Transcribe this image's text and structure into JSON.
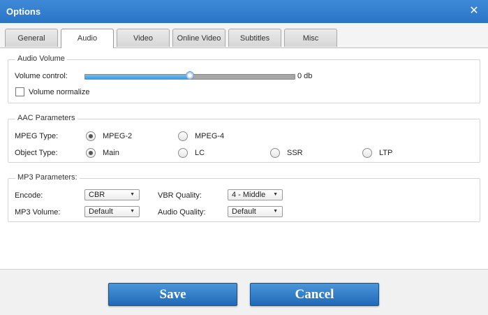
{
  "window": {
    "title": "Options"
  },
  "tabs": [
    {
      "label": "General"
    },
    {
      "label": "Audio"
    },
    {
      "label": "Video"
    },
    {
      "label": "Online Video"
    },
    {
      "label": "Subtitles"
    },
    {
      "label": "Misc"
    }
  ],
  "active_tab": "Audio",
  "audio_volume": {
    "legend": "Audio Volume",
    "volume_label": "Volume control:",
    "volume_value": "0 db",
    "volume_level": 0.5,
    "normalize_label": "Volume normalize",
    "normalize_checked": false
  },
  "aac": {
    "legend": "AAC Parameters",
    "mpeg_type_label": "MPEG Type:",
    "mpeg_options": [
      "MPEG-2",
      "MPEG-4"
    ],
    "mpeg_selected": "MPEG-2",
    "object_type_label": "Object Type:",
    "object_options": [
      "Main",
      "LC",
      "SSR",
      "LTP"
    ],
    "object_selected": "Main"
  },
  "mp3": {
    "legend": "MP3 Parameters:",
    "encode_label": "Encode:",
    "encode_value": "CBR",
    "vbr_label": "VBR Quality:",
    "vbr_value": "4 - Middle",
    "volume_label": "MP3 Volume:",
    "volume_value": "Default",
    "audio_quality_label": "Audio Quality:",
    "audio_quality_value": "Default"
  },
  "footer": {
    "save_label": "Save",
    "cancel_label": "Cancel"
  },
  "colors": {
    "titlebar": "#2f7bcd",
    "button": "#2a78c4",
    "slider_fill": "#4aa7e6"
  }
}
